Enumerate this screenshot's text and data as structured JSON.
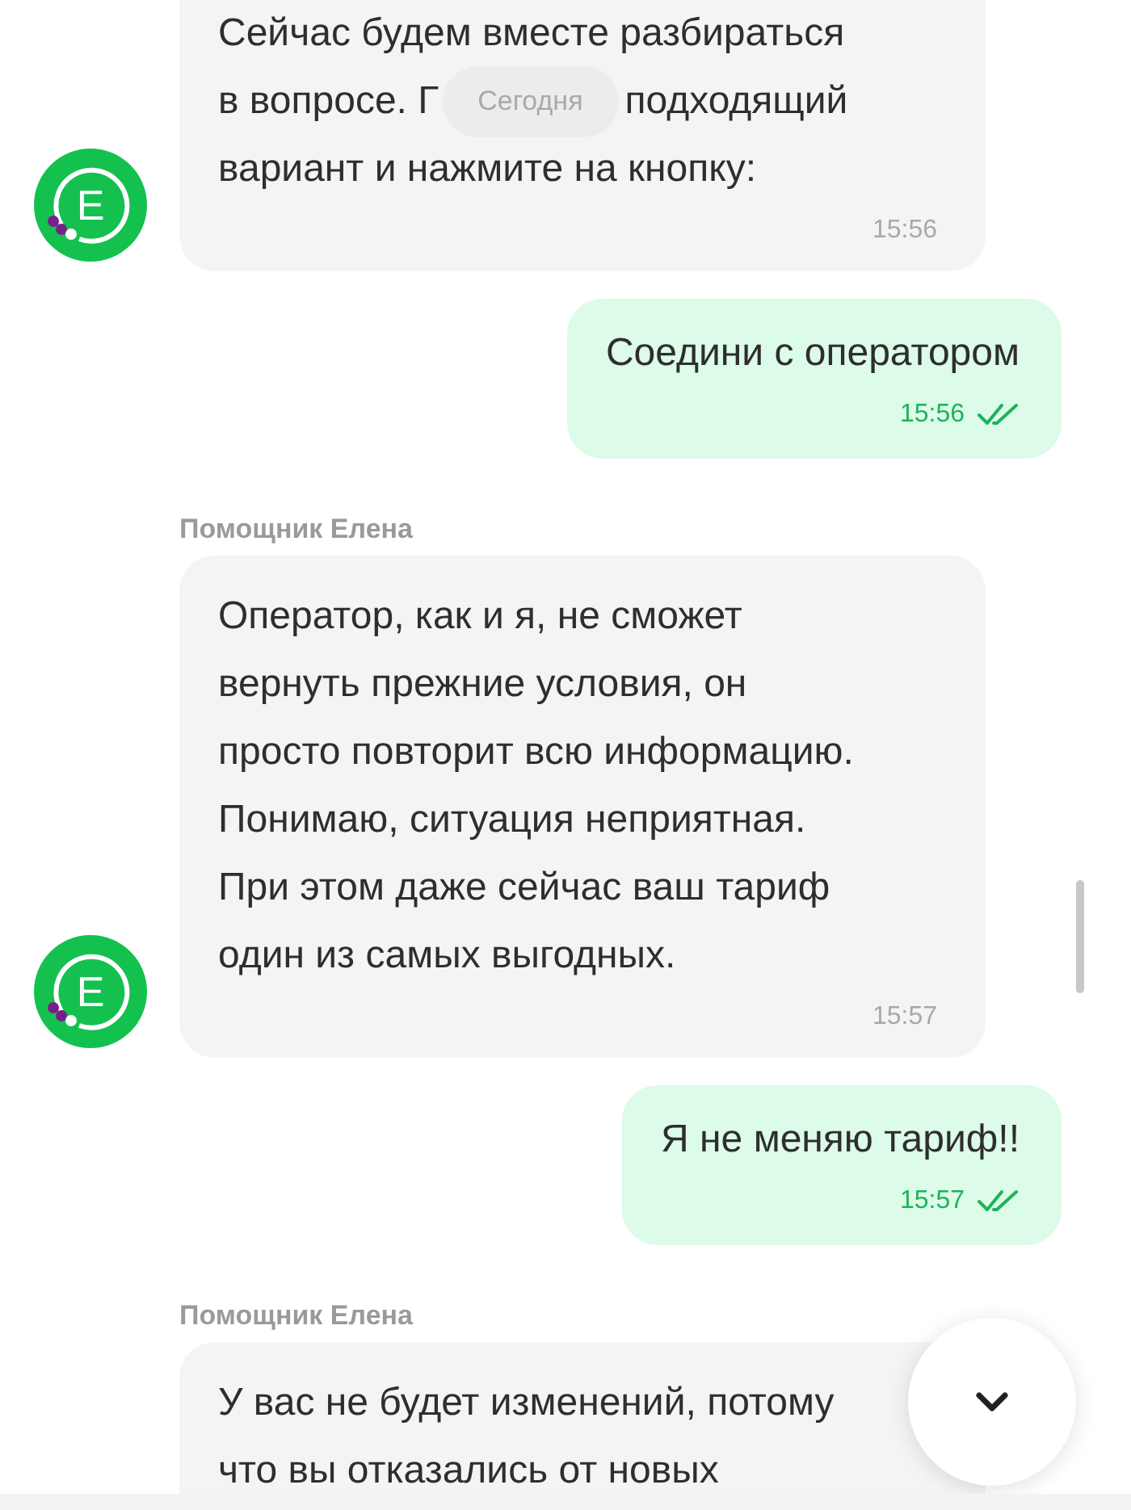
{
  "date_chip": "Сегодня",
  "messages": [
    {
      "kind": "bot",
      "avatar_letter": "E",
      "lines": [
        [
          "Сейчас будем вместе разбираться"
        ],
        [
          "в вопросе. Г",
          "подходящий"
        ],
        [
          "вариант и нажмите на кнопку:"
        ]
      ],
      "time": "15:56"
    },
    {
      "kind": "user",
      "lines": [
        [
          "Соедини с оператором"
        ]
      ],
      "time": "15:56",
      "read": true
    },
    {
      "kind": "bot",
      "sender": "Помощник Елена",
      "avatar_letter": "E",
      "lines": [
        [
          "Оператор, как и я, не сможет"
        ],
        [
          "вернуть прежние условия, он"
        ],
        [
          "просто повторит всю информацию."
        ],
        [
          "Понимаю, ситуация неприятная."
        ],
        [
          "При этом даже сейчас ваш тариф"
        ],
        [
          "один из самых выгодных."
        ]
      ],
      "time": "15:57"
    },
    {
      "kind": "user",
      "lines": [
        [
          "Я не меняю тариф!!"
        ]
      ],
      "time": "15:57",
      "read": true
    },
    {
      "kind": "bot",
      "sender": "Помощник Елена",
      "lines": [
        [
          "У вас не будет изменений, потому"
        ],
        [
          "что вы отказались от новых"
        ]
      ]
    }
  ]
}
